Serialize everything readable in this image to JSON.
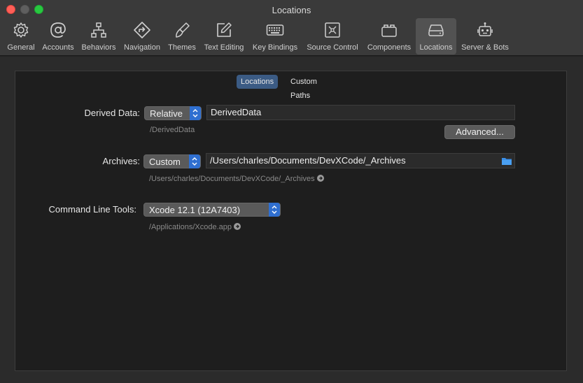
{
  "window": {
    "title": "Locations"
  },
  "toolbar": {
    "items": [
      {
        "label": "General",
        "icon": "gear-icon"
      },
      {
        "label": "Accounts",
        "icon": "at-icon"
      },
      {
        "label": "Behaviors",
        "icon": "behaviors-icon"
      },
      {
        "label": "Navigation",
        "icon": "navigation-icon"
      },
      {
        "label": "Themes",
        "icon": "brush-icon"
      },
      {
        "label": "Text Editing",
        "icon": "pencil-square-icon"
      },
      {
        "label": "Key Bindings",
        "icon": "keyboard-icon"
      },
      {
        "label": "Source Control",
        "icon": "source-control-icon"
      },
      {
        "label": "Components",
        "icon": "components-icon"
      },
      {
        "label": "Locations",
        "icon": "drive-icon"
      },
      {
        "label": "Server & Bots",
        "icon": "robot-icon"
      }
    ],
    "selected": "Locations"
  },
  "tabs": {
    "locations": "Locations",
    "custom_paths": "Custom Paths",
    "active": "Locations"
  },
  "derived_data": {
    "label": "Derived Data:",
    "mode": "Relative",
    "value": "DerivedData",
    "path": "/DerivedData",
    "advanced_label": "Advanced..."
  },
  "archives": {
    "label": "Archives:",
    "mode": "Custom",
    "value": "/Users/charles/Documents/DevXCode/_Archives",
    "path": "/Users/charles/Documents/DevXCode/_Archives"
  },
  "command_line_tools": {
    "label": "Command Line Tools:",
    "value": "Xcode 12.1 (12A7403)",
    "path": "/Applications/Xcode.app"
  },
  "colors": {
    "accent": "#2f6fd0",
    "selected_tab": "#3b5b84",
    "folder": "#3a8ee6"
  }
}
